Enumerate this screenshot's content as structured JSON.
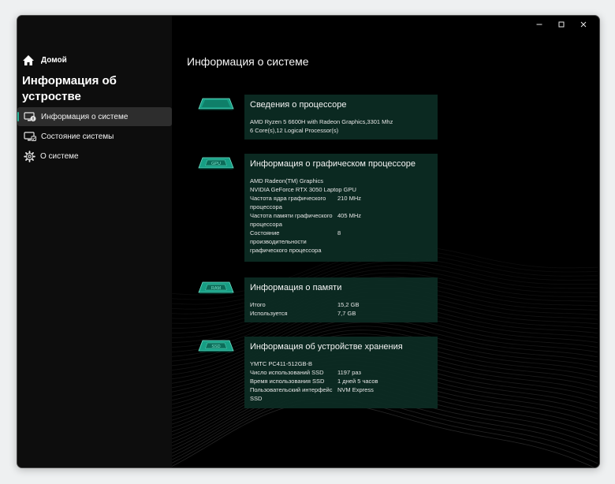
{
  "sidebar": {
    "home_label": "Домой",
    "heading": "Информация об устростве",
    "items": [
      {
        "label": "Информация о системе",
        "active": true,
        "icon": "system-info-icon"
      },
      {
        "label": "Состояние системы",
        "active": false,
        "icon": "system-status-icon"
      },
      {
        "label": "О системе",
        "active": false,
        "icon": "gear-icon"
      }
    ]
  },
  "window_controls": {
    "minimize": "–",
    "maximize": "☐",
    "close": "✕"
  },
  "main": {
    "title": "Информация о системе",
    "cpu": {
      "title": "Сведения о процессоре",
      "lines": [
        "AMD Ryzen 5 6600H with Radeon Graphics,3301 Mhz",
        "6 Core(s),12 Logical Processor(s)"
      ]
    },
    "gpu": {
      "title": "Информация о графическом процессоре",
      "chip_label": "GPU",
      "lines": [
        "AMD Radeon(TM) Graphics",
        "NVIDIA GeForce RTX 3050 Laptop GPU"
      ],
      "rows": [
        {
          "key": "Частота ядра графического процессора",
          "value": "210 MHz"
        },
        {
          "key": "Частота памяти графического процессора",
          "value": "405 MHz"
        },
        {
          "key": "Состояние производительности графического процессора",
          "value": "8"
        }
      ]
    },
    "memory": {
      "title": "Информация о памяти",
      "chip_label": "RAM",
      "rows": [
        {
          "key": "Итого",
          "value": "15,2 GB"
        },
        {
          "key": "Используется",
          "value": "7,7 GB"
        }
      ]
    },
    "storage": {
      "title": "Информация об устройстве хранения",
      "chip_label": "SSD",
      "lines": [
        "YMTC PC411-512GB-B"
      ],
      "rows": [
        {
          "key": "Число использований SSD",
          "value": "1197 раз"
        },
        {
          "key": "Время использования SSD",
          "value": "1 дней 5 часов"
        },
        {
          "key": "Пользовательский интерфейс SSD",
          "value": "NVM Express"
        }
      ]
    }
  },
  "colors": {
    "accent": "#29b59a",
    "card_bg": "#0c2c24",
    "window_bg": "#000000"
  }
}
